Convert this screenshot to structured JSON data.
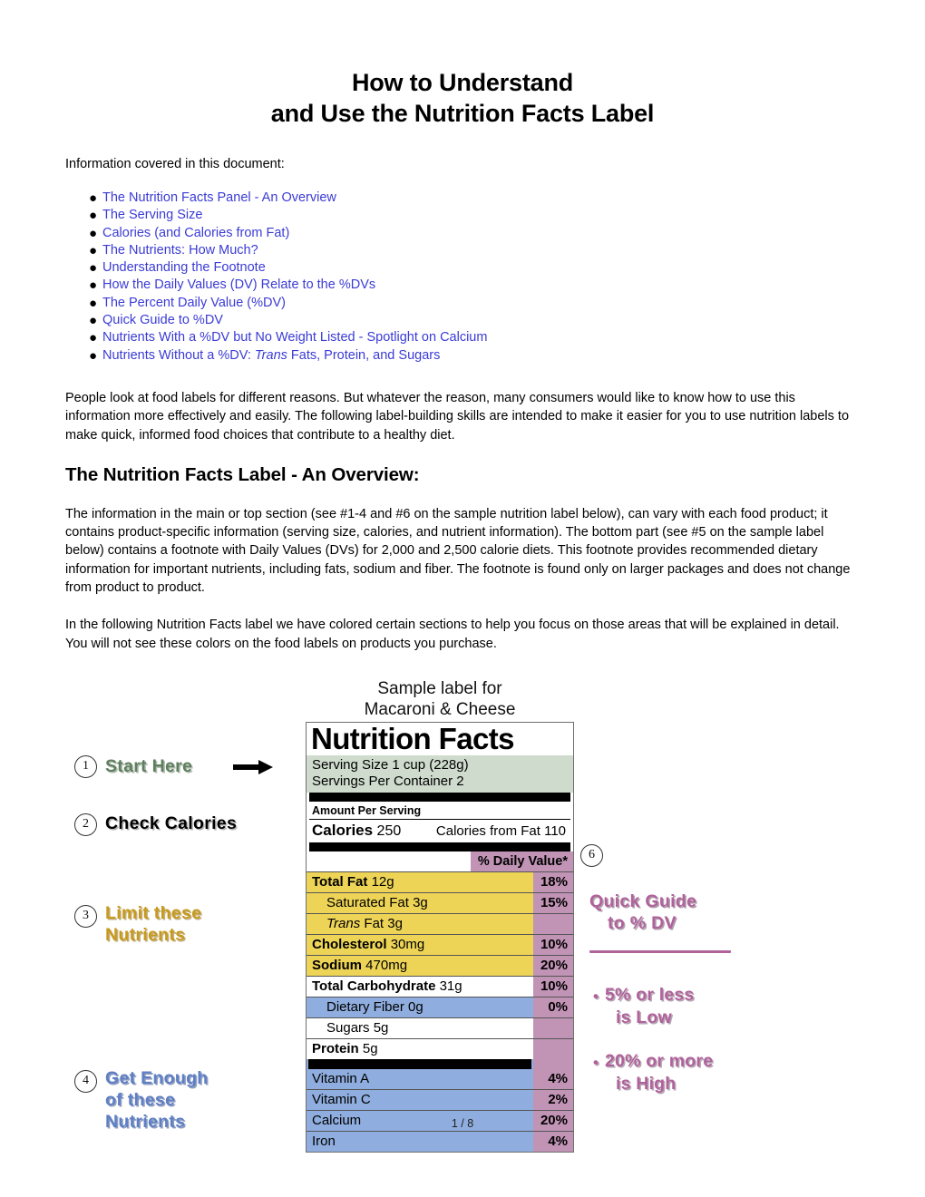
{
  "document": {
    "title_line1": "How to Understand",
    "title_line2": "and Use the Nutrition Facts Label",
    "intro_label": "Information covered in this document:",
    "footer": "1 / 8"
  },
  "toc": {
    "bullet_glyph": "●",
    "items": [
      {
        "text": "The Nutrition Facts Panel - An Overview"
      },
      {
        "text": "The Serving Size"
      },
      {
        "text": "Calories (and Calories from Fat)"
      },
      {
        "text": "The Nutrients: How Much?"
      },
      {
        "text": "Understanding the Footnote"
      },
      {
        "text": "How the Daily Values (DV) Relate to the %DVs"
      },
      {
        "text": "The Percent Daily Value (%DV)"
      },
      {
        "text": "Quick Guide to %DV"
      },
      {
        "text": "Nutrients With a %DV but No Weight Listed - Spotlight on Calcium"
      },
      {
        "pre": "Nutrients Without a %DV: ",
        "italic": "Trans",
        "post": " Fats, Protein, and Sugars"
      }
    ],
    "link_color": "#3b3bd6"
  },
  "paragraphs": {
    "p1": "People look at food labels for different reasons. But whatever the reason, many consumers would like to know how to use this information more effectively and easily. The following label-building skills are intended to make it easier for you to use nutrition labels to make quick, informed food choices that contribute to a healthy diet.",
    "section_heading": "The Nutrition Facts Label - An Overview:",
    "p2": "The information in the main or top section (see #1-4 and #6 on the sample nutrition label below), can vary with each food product; it contains product-specific information (serving size, calories, and nutrient information). The bottom part (see #5 on the sample label below) contains a footnote with Daily Values (DVs) for 2,000 and 2,500 calorie diets. This footnote provides recommended dietary information for important nutrients, including fats, sodium and fiber. The footnote is found only on larger packages and does not change from product to product.",
    "p3": "In the following Nutrition Facts label we have colored certain sections to help you focus on those areas that will be explained in detail. You will not see these colors on the food labels on products you purchase."
  },
  "figure": {
    "sample_caption_line1": "Sample label for",
    "sample_caption_line2": "Macaroni & Cheese",
    "callouts": [
      {
        "number": "1",
        "text": "Start Here",
        "color": "#5f7f5f",
        "has_arrow": true
      },
      {
        "number": "2",
        "text": "Check Calories",
        "color": "#000000",
        "has_arrow": false
      },
      {
        "number": "3",
        "line1": "Limit these",
        "line2": "Nutrients",
        "color": "#c79a1e",
        "has_arrow": false
      },
      {
        "number": "4",
        "line1": "Get Enough",
        "line2": "of these",
        "line3": "Nutrients",
        "color": "#5f7fc4",
        "has_arrow": false
      }
    ],
    "quick_guide": {
      "number": "6",
      "heading_line1": "Quick Guide",
      "heading_line2": "to % DV",
      "color": "#b0629b",
      "bullet_glyph": "•",
      "bullets": [
        {
          "line1": "5% or less",
          "line2": "is Low"
        },
        {
          "line1": "20% or more",
          "line2": "is High"
        }
      ]
    },
    "label": {
      "title": "Nutrition Facts",
      "serving_size": "Serving Size 1 cup (228g)",
      "servings_per_container": "Servings Per Container  2",
      "amount_per_serving": "Amount Per Serving",
      "calories_label": "Calories",
      "calories_value": "250",
      "calories_from_fat": "Calories from Fat 110",
      "daily_value_header": "% Daily Value*",
      "rows": [
        {
          "name": "Total Fat",
          "bold": true,
          "amount": "12g",
          "dv": "18%",
          "bg": "#edd457",
          "indent": false,
          "italic": false
        },
        {
          "name": "Saturated Fat",
          "bold": false,
          "amount": "3g",
          "dv": "15%",
          "bg": "#edd457",
          "indent": true,
          "italic": false
        },
        {
          "name": "Trans",
          "bold": false,
          "amount": "Fat 3g",
          "dv": "",
          "bg": "#edd457",
          "indent": true,
          "italic": true
        },
        {
          "name": "Cholesterol",
          "bold": true,
          "amount": "30mg",
          "dv": "10%",
          "bg": "#edd457",
          "indent": false,
          "italic": false
        },
        {
          "name": "Sodium",
          "bold": true,
          "amount": "470mg",
          "dv": "20%",
          "bg": "#edd457",
          "indent": false,
          "italic": false
        },
        {
          "name": "Total Carbohydrate",
          "bold": true,
          "amount": "31g",
          "dv": "10%",
          "bg": "#ffffff",
          "indent": false,
          "italic": false
        },
        {
          "name": "Dietary Fiber",
          "bold": false,
          "amount": "0g",
          "dv": "0%",
          "bg": "#8fadde",
          "indent": true,
          "italic": false
        },
        {
          "name": "Sugars",
          "bold": false,
          "amount": "5g",
          "dv": "",
          "bg": "#ffffff",
          "indent": true,
          "italic": false
        },
        {
          "name": "Protein",
          "bold": true,
          "amount": "5g",
          "dv": "",
          "bg": "#ffffff",
          "indent": false,
          "italic": false
        }
      ],
      "vitamin_rows": [
        {
          "name": "Vitamin A",
          "dv": "4%",
          "bg": "#8fadde"
        },
        {
          "name": "Vitamin C",
          "dv": "2%",
          "bg": "#8fadde"
        },
        {
          "name": "Calcium",
          "dv": "20%",
          "bg": "#8fadde"
        },
        {
          "name": "Iron",
          "dv": "4%",
          "bg": "#8fadde"
        }
      ],
      "colors": {
        "serving_bg": "#cfdbcd",
        "dv_column": "#c193b5",
        "limit_bg": "#edd457",
        "get_enough_bg": "#8fadde",
        "border": "#6f6f6f"
      }
    }
  }
}
